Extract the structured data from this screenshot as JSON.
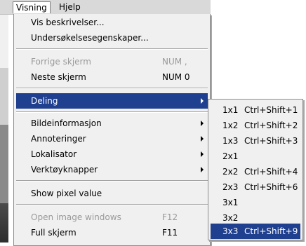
{
  "menubar": {
    "visning": "Visning",
    "hjelp": "Hjelp"
  },
  "menu": {
    "vis_beskrivelser": "Vis beskrivelser...",
    "undersokelsesegenskaper": "Undersøkelsesegenskaper...",
    "forrige_skjerm": "Forrige skjerm",
    "forrige_skjerm_shortcut": "NUM ,",
    "neste_skjerm": "Neste skjerm",
    "neste_skjerm_shortcut": "NUM 0",
    "deling": "Deling",
    "bildeinformasjon": "Bildeinformasjon",
    "annoteringer": "Annoteringer",
    "lokalisator": "Lokalisator",
    "verktoyknapper": "Verktøyknapper",
    "show_pixel_value": "Show pixel value",
    "open_image_windows": "Open image windows",
    "open_image_windows_shortcut": "F12",
    "full_skjerm": "Full skjerm",
    "full_skjerm_shortcut": "F11"
  },
  "submenu": {
    "items": [
      {
        "code": "1x1",
        "shortcut": "Ctrl+Shift+1"
      },
      {
        "code": "1x2",
        "shortcut": "Ctrl+Shift+2"
      },
      {
        "code": "1x3",
        "shortcut": "Ctrl+Shift+3"
      },
      {
        "code": "2x1",
        "shortcut": ""
      },
      {
        "code": "2x2",
        "shortcut": "Ctrl+Shift+4"
      },
      {
        "code": "2x3",
        "shortcut": "Ctrl+Shift+6"
      },
      {
        "code": "3x1",
        "shortcut": ""
      },
      {
        "code": "3x2",
        "shortcut": ""
      },
      {
        "code": "3x3",
        "shortcut": "Ctrl+Shift+9"
      }
    ]
  },
  "colors": {
    "highlight": "#1f3f8f",
    "menu_bg": "#f0f0f0",
    "disabled_text": "#9a9a9a"
  }
}
